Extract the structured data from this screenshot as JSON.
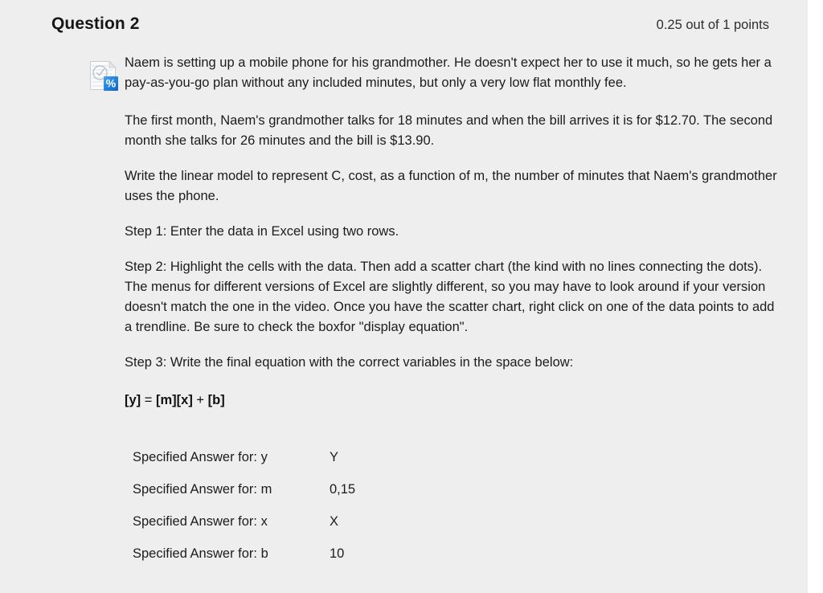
{
  "header": {
    "question_title": "Question 2",
    "points": "0.25 out of 1 points"
  },
  "icon": {
    "name": "excel-percent-document-icon",
    "badge_glyph": "%",
    "badge_color": "#1f7fe0"
  },
  "body": {
    "paragraphs": [
      "Naem is setting up a mobile phone for his grandmother. He doesn't expect her to use it much, so he gets her a pay-as-you-go plan without any included minutes, but only a very low flat monthly fee.",
      "The first month, Naem's grandmother talks for 18 minutes and when the bill arrives it is for $12.70. The second month she talks for 26 minutes and the bill is $13.90.",
      "Write the linear model to represent C, cost, as a function of m, the number of minutes that Naem's grandmother uses the phone.",
      "Step 1: Enter the data in Excel using two rows.",
      "Step 2: Highlight the cells with the data. Then add a scatter chart (the kind with no lines connecting the dots).  The menus for different versions of Excel are slightly different, so you may have to look around if your version doesn't match the one in the video.  Once you have the scatter chart, right click on one of the data points to add a trendline.  Be sure to check the boxfor \"display equation\".",
      "Step 3: Write the final equation with the correct variables in the space below:"
    ],
    "equation": {
      "y": "[y]",
      "equals": " = ",
      "m": "[m]",
      "x": "[x]",
      "plus": " + ",
      "b": "[b]"
    }
  },
  "answers": [
    {
      "label": "Specified Answer for: y",
      "value": "Y"
    },
    {
      "label": "Specified Answer for: m",
      "value": "0,15"
    },
    {
      "label": "Specified Answer for: x",
      "value": "X"
    },
    {
      "label": "Specified Answer for: b",
      "value": "10"
    }
  ],
  "colors": {
    "panel_background": "#eeeeee",
    "page_background": "#ffffff",
    "text": "#1c1c1c",
    "title": "#161616"
  }
}
